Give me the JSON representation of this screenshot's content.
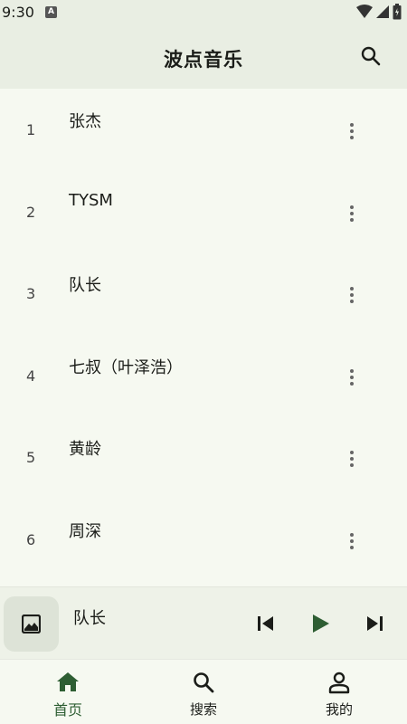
{
  "status_bar": {
    "time": "9:30",
    "a_badge": "A",
    "icons": [
      "wifi-icon",
      "signal-icon",
      "battery-icon"
    ]
  },
  "app_bar": {
    "title": "波点音乐",
    "search_icon": "search-icon"
  },
  "songs": [
    {
      "index": "1",
      "name": "张杰"
    },
    {
      "index": "2",
      "name": "TYSM"
    },
    {
      "index": "3",
      "name": "队长"
    },
    {
      "index": "4",
      "name": "七叔（叶泽浩）"
    },
    {
      "index": "5",
      "name": "黄龄"
    },
    {
      "index": "6",
      "name": "周深"
    }
  ],
  "mini_player": {
    "title": "队长",
    "cover_icon": "image-icon",
    "controls": [
      "skip-previous-icon",
      "play-icon",
      "skip-next-icon"
    ]
  },
  "bottom_nav": [
    {
      "label": "首页",
      "icon": "home-icon",
      "active": true
    },
    {
      "label": "搜索",
      "icon": "search-icon",
      "active": false
    },
    {
      "label": "我的",
      "icon": "person-icon",
      "active": false
    }
  ],
  "colors": {
    "accent": "#2e5e33",
    "background": "#f6f9f1",
    "app_bar": "#e9eee3"
  }
}
